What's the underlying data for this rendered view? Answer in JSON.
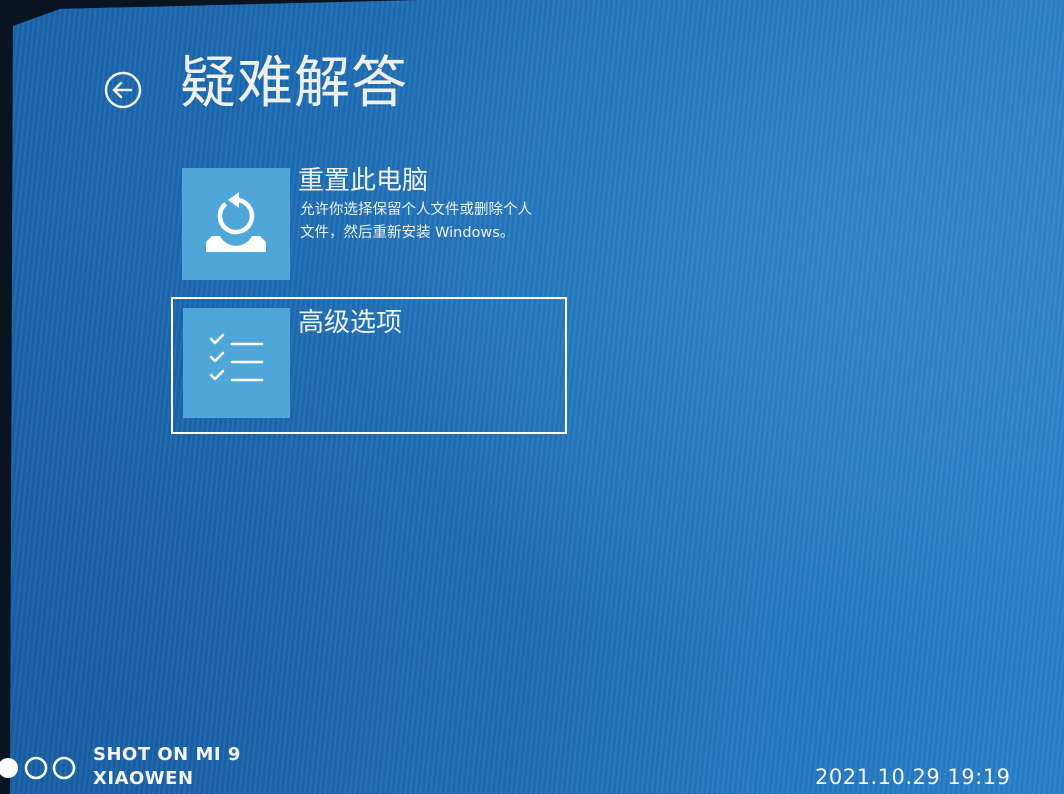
{
  "screen": {
    "title": "疑难解答",
    "back_button": {
      "icon": "back-arrow-icon"
    },
    "options": [
      {
        "title": "重置此电脑",
        "description": [
          "允许你选择保留个人文件或删除个人",
          "文件，然后重新安装 Windows。"
        ],
        "icon": "reset-pc-icon",
        "selected": false
      },
      {
        "title": "高级选项",
        "description": [],
        "icon": "checklist-icon",
        "selected": true
      }
    ]
  },
  "photo_overlay": {
    "watermark_line1": "SHOT ON MI 9",
    "watermark_line2": "XIAOWEN",
    "timestamp": "2021.10.29 19:19"
  },
  "colors": {
    "background": "#1f70b9",
    "tile_icon_bg": "#4ea6d9",
    "text": "#eef0ea",
    "selection_border": "#ffffff"
  }
}
